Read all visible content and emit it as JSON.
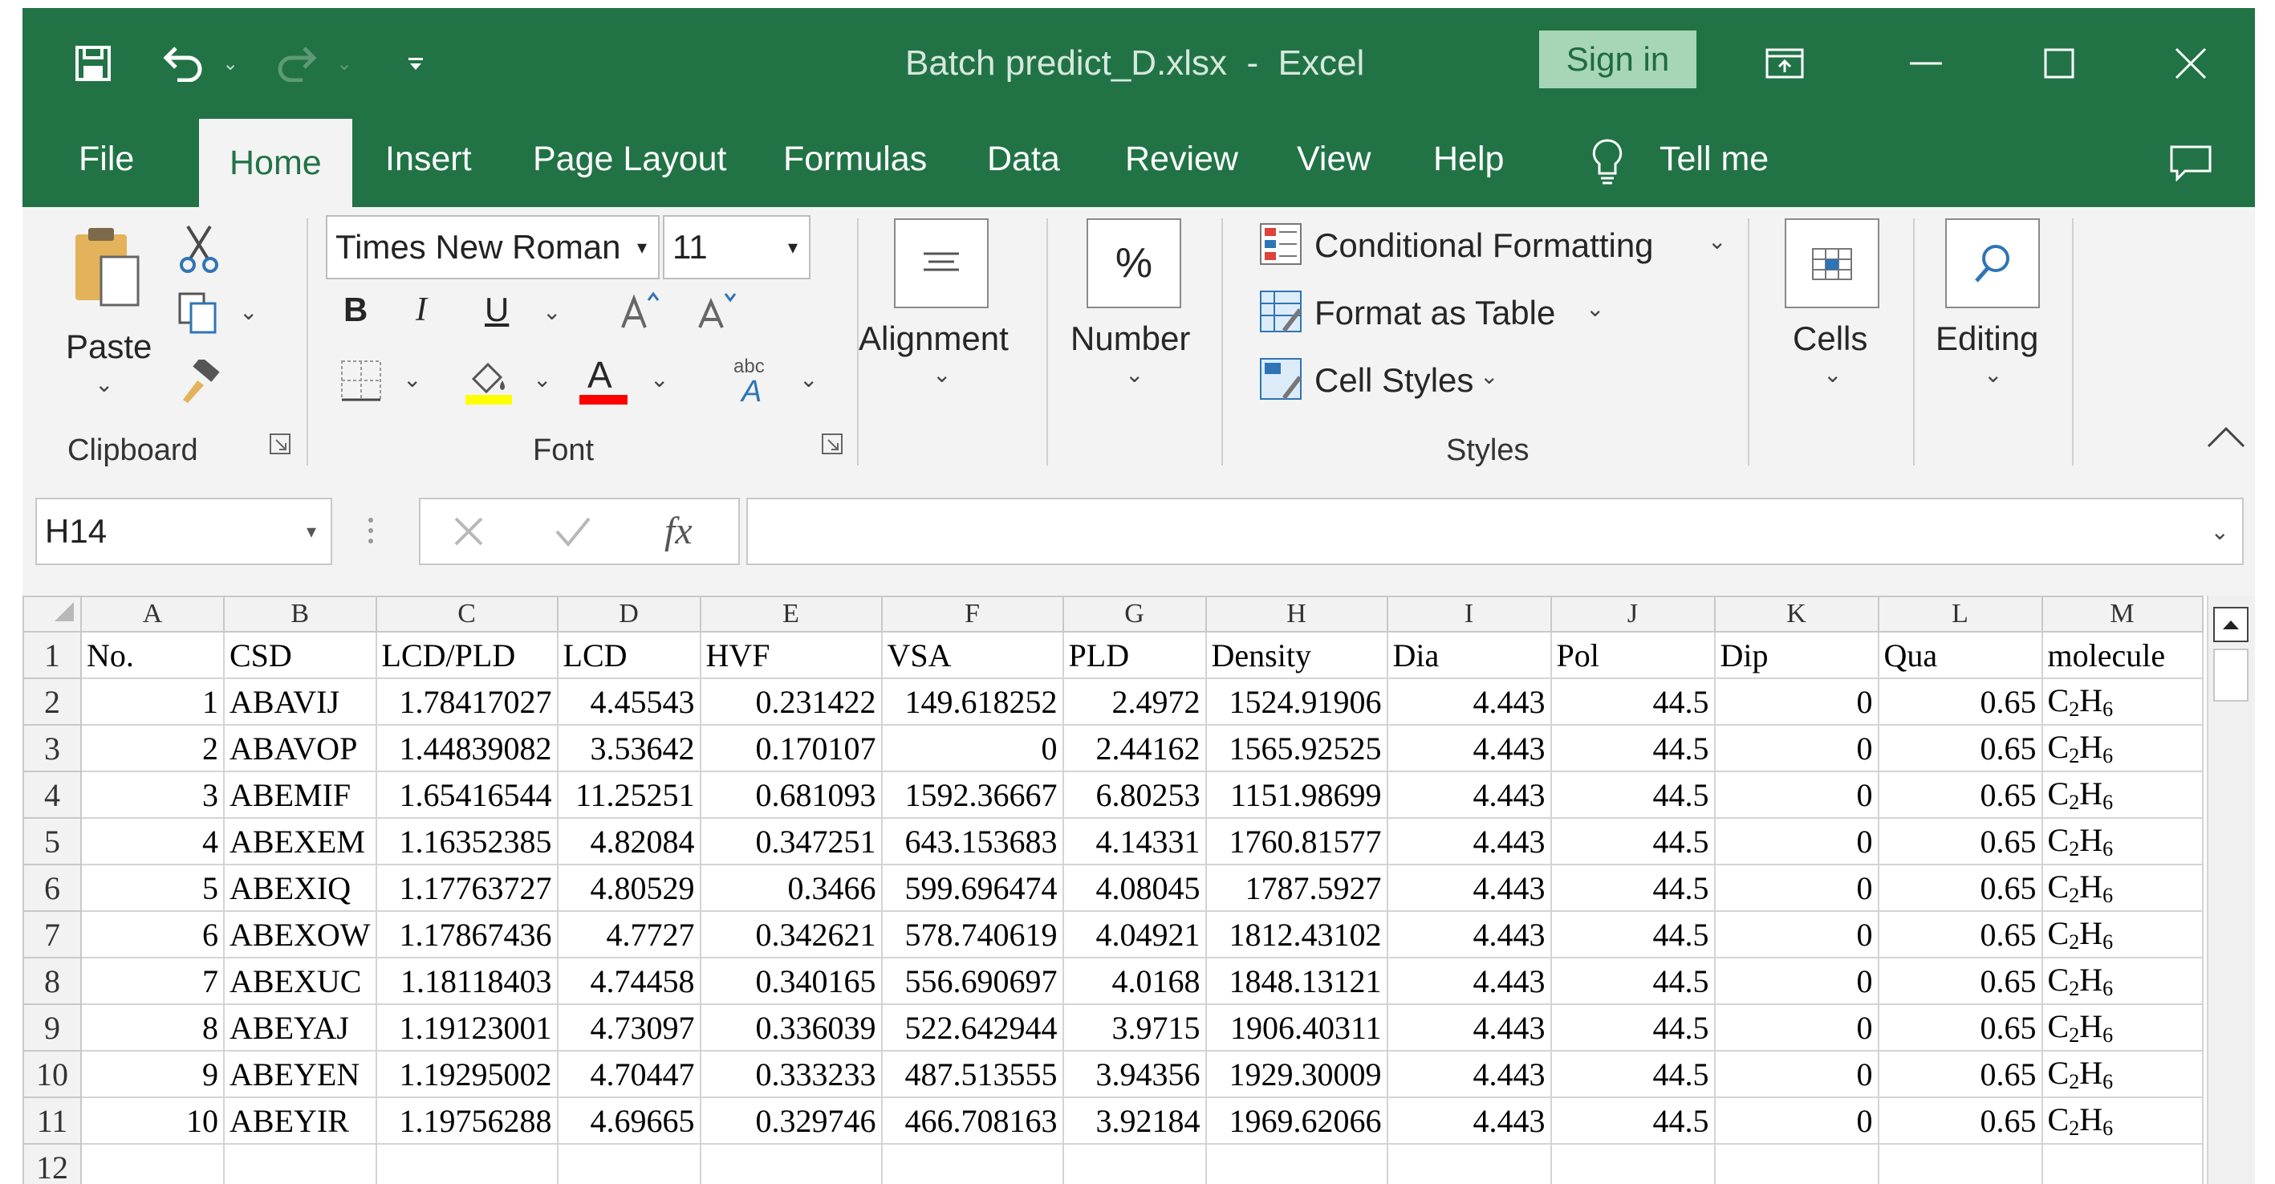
{
  "titlebar": {
    "file_name": "Batch predict_D.xlsx",
    "separator": "-",
    "app_name": "Excel",
    "sign_in": "Sign in"
  },
  "tabs": [
    "File",
    "Home",
    "Insert",
    "Page Layout",
    "Formulas",
    "Data",
    "Review",
    "View",
    "Help",
    "Tell me"
  ],
  "ribbon": {
    "paste_label": "Paste",
    "clipboard_label": "Clipboard",
    "font_name": "Times New Roman",
    "font_size": "11",
    "font_label": "Font",
    "bold": "B",
    "italic": "I",
    "underline": "U",
    "font_color_glyph": "A",
    "alignment_label": "Alignment",
    "number_label": "Number",
    "percent_glyph": "%",
    "conditional_formatting": "Conditional Formatting",
    "format_as_table": "Format as Table",
    "cell_styles": "Cell Styles",
    "styles_label": "Styles",
    "cells_label": "Cells",
    "editing_label": "Editing"
  },
  "formula_bar": {
    "name_box": "H14",
    "fx": "fx",
    "formula": ""
  },
  "colors": {
    "title_green": "#217346",
    "signin_bg": "#a6d6b5",
    "highlight_yellow": "#ffff00",
    "font_red": "#ff0000"
  },
  "sheet": {
    "column_letters": [
      "A",
      "B",
      "C",
      "D",
      "E",
      "F",
      "G",
      "H",
      "I",
      "J",
      "K",
      "L",
      "M"
    ],
    "header_row": [
      "No.",
      "CSD",
      "LCD/PLD",
      "LCD",
      "HVF",
      "VSA",
      "PLD",
      "Density",
      "Dia",
      "Pol",
      "Dip",
      "Qua",
      "molecule"
    ],
    "rows": [
      [
        "1",
        "ABAVIJ",
        "1.78417027",
        "4.45543",
        "0.231422",
        "149.618252",
        "2.4972",
        "1524.91906",
        "4.443",
        "44.5",
        "0",
        "0.65"
      ],
      [
        "2",
        "ABAVOP",
        "1.44839082",
        "3.53642",
        "0.170107",
        "0",
        "2.44162",
        "1565.92525",
        "4.443",
        "44.5",
        "0",
        "0.65"
      ],
      [
        "3",
        "ABEMIF",
        "1.65416544",
        "11.25251",
        "0.681093",
        "1592.36667",
        "6.80253",
        "1151.98699",
        "4.443",
        "44.5",
        "0",
        "0.65"
      ],
      [
        "4",
        "ABEXEM",
        "1.16352385",
        "4.82084",
        "0.347251",
        "643.153683",
        "4.14331",
        "1760.81577",
        "4.443",
        "44.5",
        "0",
        "0.65"
      ],
      [
        "5",
        "ABEXIQ",
        "1.17763727",
        "4.80529",
        "0.3466",
        "599.696474",
        "4.08045",
        "1787.5927",
        "4.443",
        "44.5",
        "0",
        "0.65"
      ],
      [
        "6",
        "ABEXOW",
        "1.17867436",
        "4.7727",
        "0.342621",
        "578.740619",
        "4.04921",
        "1812.43102",
        "4.443",
        "44.5",
        "0",
        "0.65"
      ],
      [
        "7",
        "ABEXUC",
        "1.18118403",
        "4.74458",
        "0.340165",
        "556.690697",
        "4.0168",
        "1848.13121",
        "4.443",
        "44.5",
        "0",
        "0.65"
      ],
      [
        "8",
        "ABEYAJ",
        "1.19123001",
        "4.73097",
        "0.336039",
        "522.642944",
        "3.9715",
        "1906.40311",
        "4.443",
        "44.5",
        "0",
        "0.65"
      ],
      [
        "9",
        "ABEYEN",
        "1.19295002",
        "4.70447",
        "0.333233",
        "487.513555",
        "3.94356",
        "1929.30009",
        "4.443",
        "44.5",
        "0",
        "0.65"
      ],
      [
        "10",
        "ABEYIR",
        "1.19756288",
        "4.69665",
        "0.329746",
        "466.708163",
        "3.92184",
        "1969.62066",
        "4.443",
        "44.5",
        "0",
        "0.65"
      ]
    ],
    "molecule": {
      "c": "C",
      "c_sub": "2",
      "h": "H",
      "h_sub": "6"
    }
  }
}
